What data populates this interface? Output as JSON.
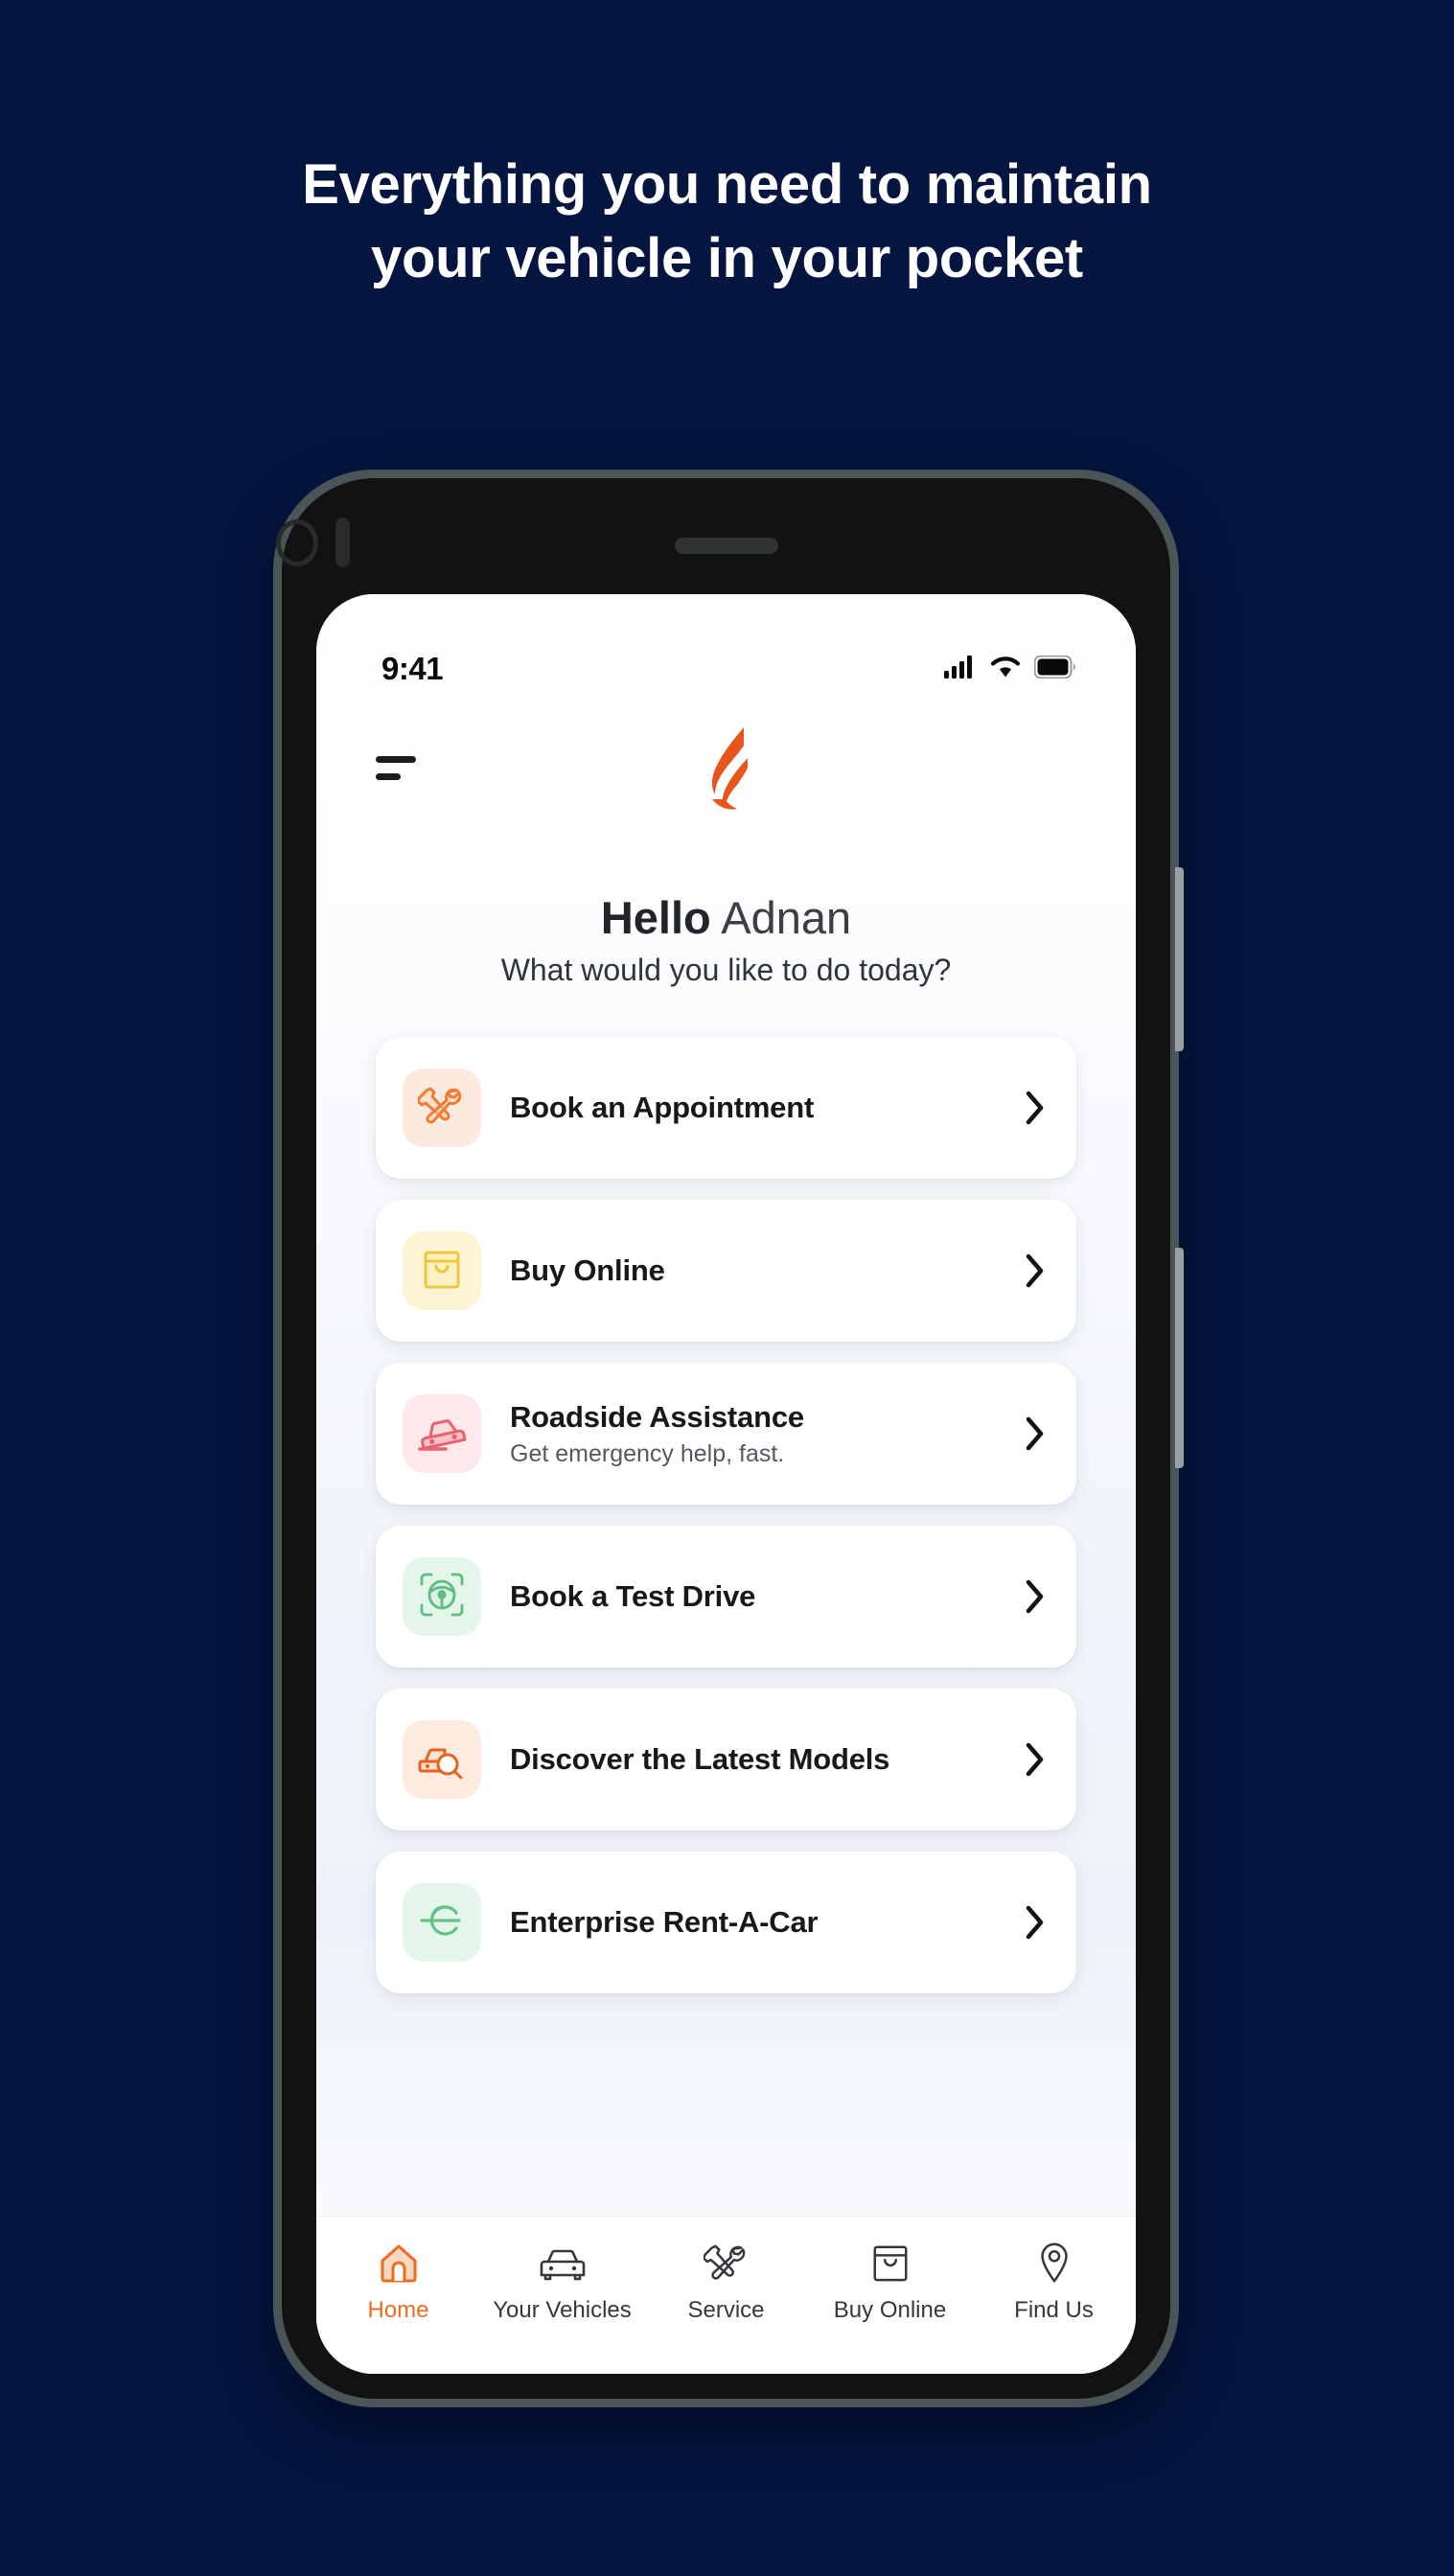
{
  "marketing": {
    "headline_line1": "Everything you need to maintain",
    "headline_line2": "your vehicle in your pocket"
  },
  "colors": {
    "background": "#041540",
    "brand_orange": "#ef6b1f",
    "text_dark": "#16181a"
  },
  "phone": {
    "status_bar": {
      "time": "9:41",
      "icons": [
        "cellular-signal-icon",
        "wifi-icon",
        "battery-icon"
      ]
    },
    "app_header": {
      "menu_icon": "hamburger-menu-icon",
      "logo": "brand-flame-logo"
    },
    "greeting": {
      "hello": "Hello",
      "name": "Adnan",
      "prompt": "What would you like to do today?"
    },
    "cards": [
      {
        "title": "Book an Appointment",
        "subtitle": "",
        "icon": "tools-wrench-screwdriver-icon",
        "icon_color": "#f07b33",
        "icon_bg": "#fdeade",
        "chevron": "chevron-right-icon"
      },
      {
        "title": "Buy Online",
        "subtitle": "",
        "icon": "shopping-bag-icon",
        "icon_color": "#f2c94c",
        "icon_bg": "#fdf4d3",
        "chevron": "chevron-right-icon"
      },
      {
        "title": "Roadside Assistance",
        "subtitle": "Get emergency help, fast.",
        "icon": "tilted-car-breakdown-icon",
        "icon_color": "#e8616d",
        "icon_bg": "#fde8ea",
        "chevron": "chevron-right-icon"
      },
      {
        "title": "Book a Test Drive",
        "subtitle": "",
        "icon": "steering-wheel-icon",
        "icon_color": "#5cbd7f",
        "icon_bg": "#e4f6ea",
        "chevron": "chevron-right-icon"
      },
      {
        "title": "Discover the Latest Models",
        "subtitle": "",
        "icon": "car-search-icon",
        "icon_color": "#e8621f",
        "icon_bg": "#fdebe0",
        "chevron": "chevron-right-icon"
      },
      {
        "title": "Enterprise Rent-A-Car",
        "subtitle": "",
        "icon": "enterprise-e-logo-icon",
        "icon_color": "#64c187",
        "icon_bg": "#e4f6ea",
        "chevron": "chevron-right-icon"
      }
    ],
    "bottom_nav": [
      {
        "label": "Home",
        "icon": "home-icon",
        "active": true
      },
      {
        "label": "Your Vehicles",
        "icon": "car-front-icon",
        "active": false
      },
      {
        "label": "Service",
        "icon": "tools-wrench-screwdriver-icon",
        "active": false
      },
      {
        "label": "Buy Online",
        "icon": "shopping-bag-icon",
        "active": false
      },
      {
        "label": "Find Us",
        "icon": "map-pin-icon",
        "active": false
      }
    ]
  }
}
